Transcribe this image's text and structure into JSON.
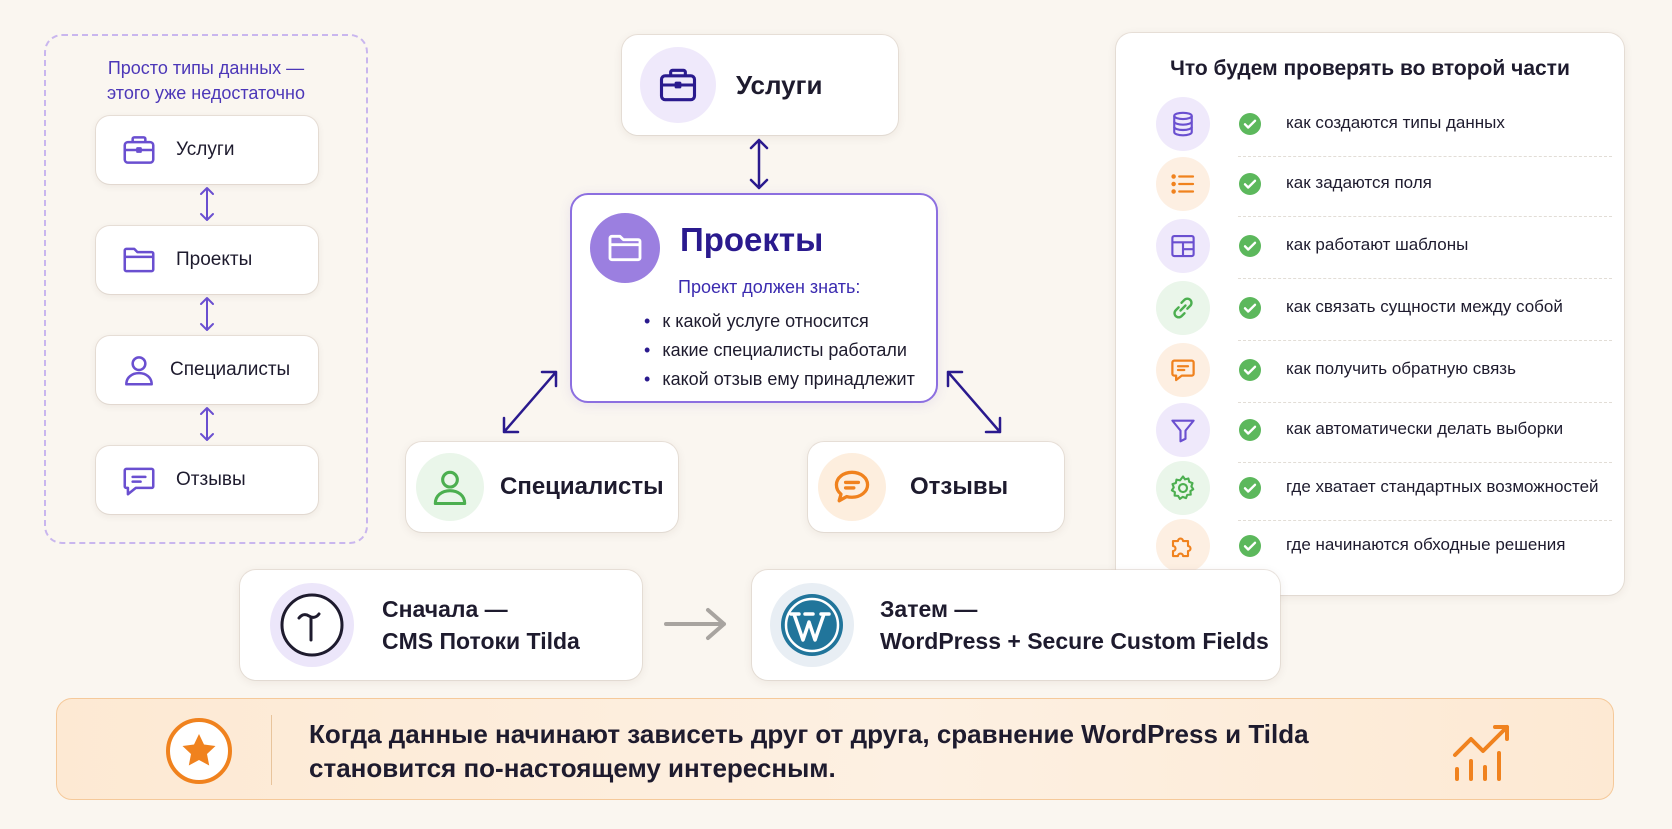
{
  "left_panel": {
    "caption_line1": "Просто типы данных —",
    "caption_line2": "этого уже недостаточно",
    "items": [
      {
        "label": "Услуги",
        "icon": "briefcase-icon"
      },
      {
        "label": "Проекты",
        "icon": "folder-icon"
      },
      {
        "label": "Специалисты",
        "icon": "user-icon"
      },
      {
        "label": "Отзывы",
        "icon": "chat-icon"
      }
    ]
  },
  "diagram": {
    "services": {
      "label": "Услуги",
      "icon": "briefcase-icon"
    },
    "projects": {
      "title": "Проекты",
      "subtitle": "Проект должен знать:",
      "bullets": [
        "к какой услуге относится",
        "какие специалисты работали",
        "какой отзыв ему принадлежит"
      ],
      "icon": "folder-icon"
    },
    "specialists": {
      "label": "Специалисты",
      "icon": "user-icon"
    },
    "reviews": {
      "label": "Отзывы",
      "icon": "chat-icon"
    }
  },
  "checklist": {
    "title": "Что будем проверять во второй части",
    "items": [
      {
        "text": "как создаются типы данных",
        "icon": "database-icon"
      },
      {
        "text": "как задаются поля",
        "icon": "list-icon"
      },
      {
        "text": "как работают шаблоны",
        "icon": "layout-icon"
      },
      {
        "text": "как связать сущности между собой",
        "icon": "link-icon"
      },
      {
        "text": "как получить обратную связь",
        "icon": "message-icon"
      },
      {
        "text": "как автоматически делать выборки",
        "icon": "filter-icon"
      },
      {
        "text": "где хватает стандартных возможностей",
        "icon": "gear-icon"
      },
      {
        "text": "где начинаются обходные решения",
        "icon": "puzzle-icon"
      }
    ]
  },
  "cms": {
    "first": {
      "line1": "Сначала —",
      "line2": "CMS Потоки Tilda",
      "logo": "tilda-logo",
      "logo_letter": "T"
    },
    "second": {
      "line1": "Затем —",
      "line2": "WordPress + Secure Custom Fields",
      "logo": "wordpress-logo",
      "logo_letter": "W"
    }
  },
  "banner": {
    "line1": "Когда данные начинают зависеть друг от друга, сравнение WordPress и Tilda",
    "line2": "становится по-настоящему интересным."
  },
  "colors": {
    "purple": "#6a4fd0",
    "navy": "#2a1a8e",
    "green": "#4caf50",
    "orange": "#f0821e",
    "check_green": "#5cb85c",
    "wordpress_blue": "#21759b"
  }
}
